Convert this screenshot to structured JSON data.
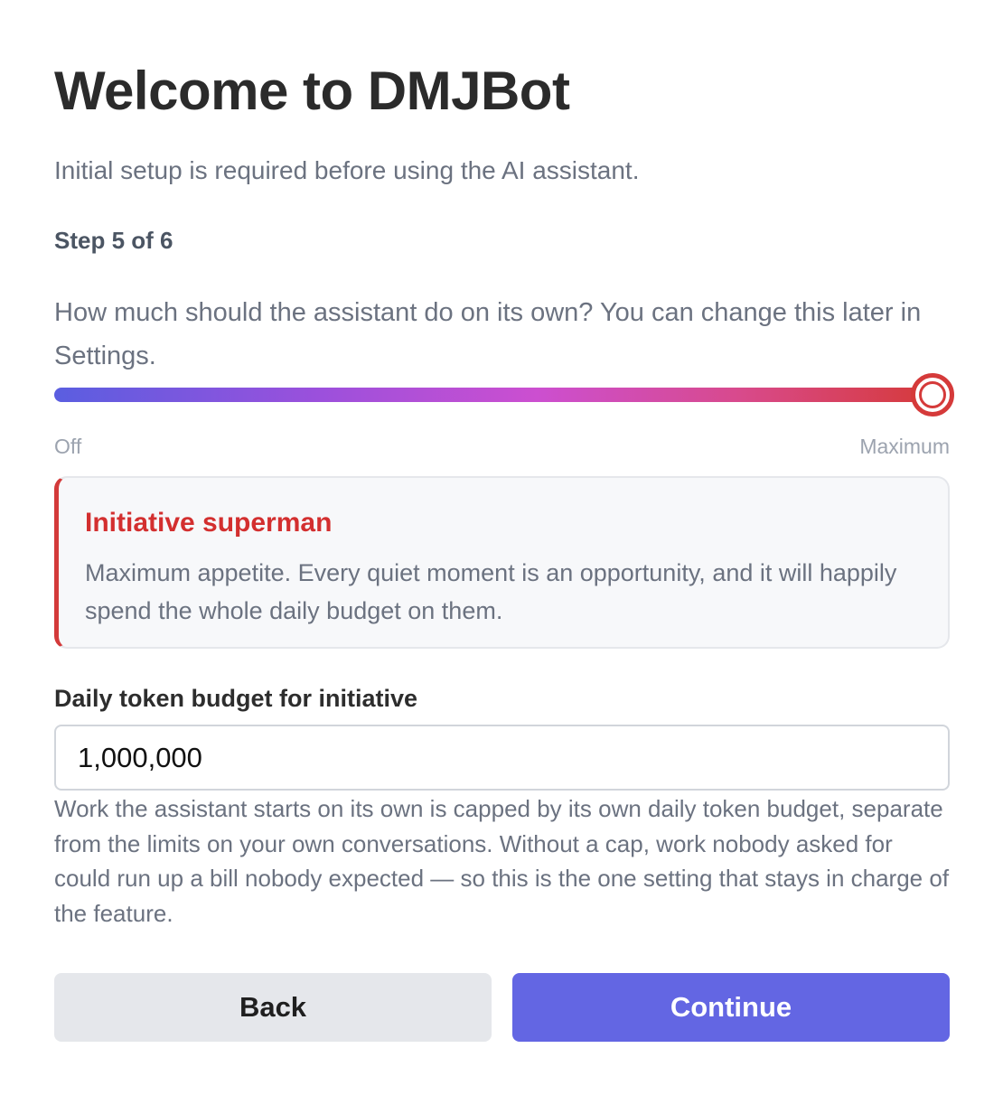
{
  "header": {
    "title": "Welcome to DMJBot",
    "subtitle": "Initial setup is required before using the AI assistant."
  },
  "progress": {
    "step_label": "Step 5 of 6",
    "current_step": 5,
    "total_steps": 6
  },
  "initiative": {
    "question": "How much should the assistant do on its own? You can change this later in Settings.",
    "slider": {
      "value_fraction": 1.0,
      "min_label": "Off",
      "max_label": "Maximum"
    },
    "level": {
      "name": "Initiative superman",
      "description": "Maximum appetite. Every quiet moment is an opportunity, and it will happily spend the whole daily budget on them.",
      "accent_color": "#d32f2f"
    }
  },
  "budget": {
    "label": "Daily token budget for initiative",
    "value": "1,000,000",
    "help": "Work the assistant starts on its own is capped by its own daily token budget, separate from the limits on your own conversations. Without a cap, work nobody asked for could run up a bill nobody expected — so this is the one setting that stays in charge of the feature."
  },
  "actions": {
    "back_label": "Back",
    "continue_label": "Continue",
    "primary_color": "#6366e3"
  }
}
